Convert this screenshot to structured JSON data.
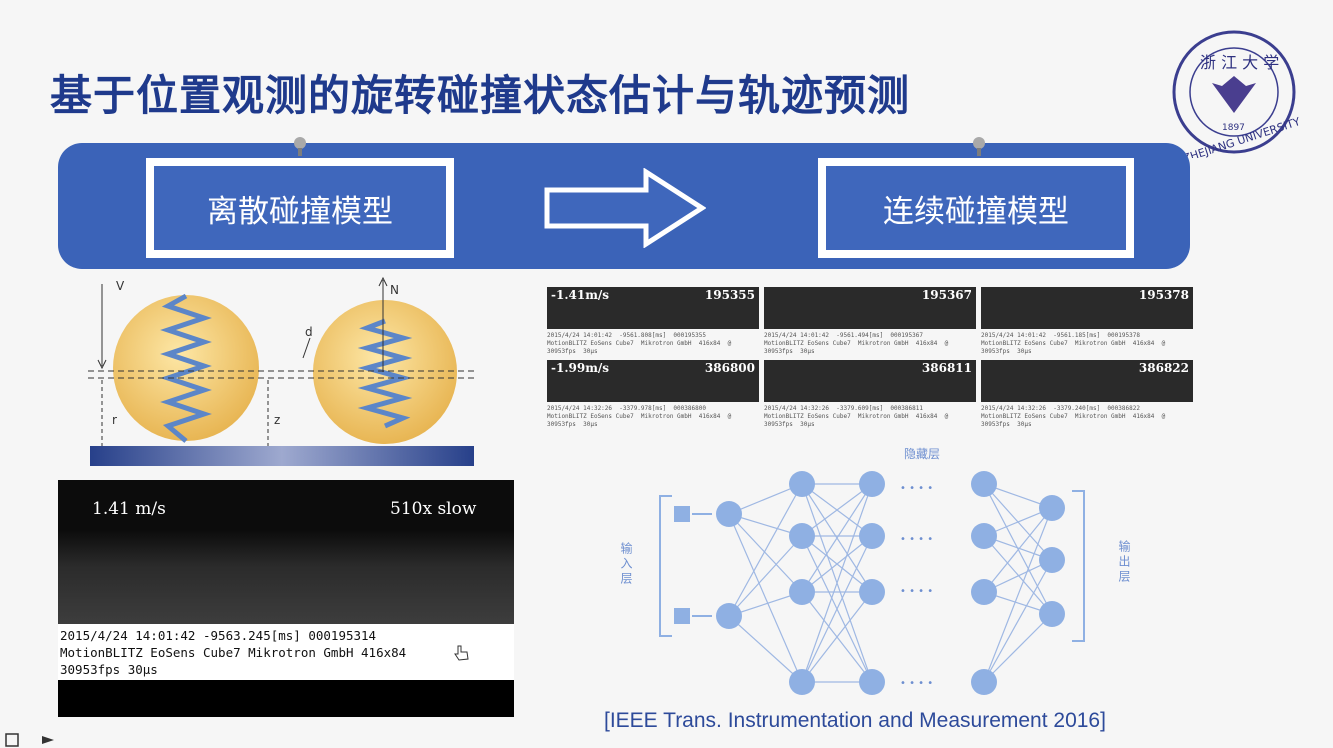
{
  "title": "基于位置观测的旋转碰撞状态估计与轨迹预测",
  "banner": {
    "left_label": "离散碰撞模型",
    "right_label": "连续碰撞模型"
  },
  "diagram": {
    "v_label": "V",
    "n_label": "N",
    "dc_label": "d",
    "r_label": "r",
    "z_label": "z"
  },
  "frames": [
    {
      "speed": "-1.41m/s",
      "id": "195355",
      "caption": "2015/4/24 14:01:42  -9561.808[ms]  000195355\nMotionBLITZ EoSens Cube7  Mikrotron GmbH  416x84  @\n30953fps  30µs"
    },
    {
      "speed": "",
      "id": "195367",
      "caption": "2015/4/24 14:01:42  -9561.494[ms]  000195367\nMotionBLITZ EoSens Cube7  Mikrotron GmbH  416x84  @\n30953fps  30µs"
    },
    {
      "speed": "",
      "id": "195378",
      "caption": "2015/4/24 14:01:42  -9561.185[ms]  000195378\nMotionBLITZ EoSens Cube7  Mikrotron GmbH  416x84  @\n30953fps  30µs"
    },
    {
      "speed": "-1.99m/s",
      "id": "386800",
      "caption": "2015/4/24 14:32:26  -3379.978[ms]  000386800\nMotionBLITZ EoSens Cube7  Mikrotron GmbH  416x84  @\n30953fps  30µs"
    },
    {
      "speed": "",
      "id": "386811",
      "caption": "2015/4/24 14:32:26  -3379.609[ms]  000386811\nMotionBLITZ EoSens Cube7  Mikrotron GmbH  416x84  @\n30953fps  30µs"
    },
    {
      "speed": "",
      "id": "386822",
      "caption": "2015/4/24 14:32:26  -3379.240[ms]  000386822\nMotionBLITZ EoSens Cube7  Mikrotron GmbH  416x84  @\n30953fps  30µs"
    }
  ],
  "video": {
    "speed": "1.41 m/s",
    "slow": "510x slow",
    "info_line1": "2015/4/24 14:01:42  -9563.245[ms]  000195314",
    "info_line2": "MotionBLITZ EoSens Cube7  Mikrotron GmbH  416x84",
    "info_line3": "30953fps  30µs"
  },
  "network": {
    "hidden_label": "隐藏层",
    "input_label": "输入层",
    "output_label": "输出层",
    "ellipsis": "• • • •"
  },
  "logo": {
    "name_cn": "浙 江 大 学",
    "year": "1897",
    "name_en": "ZHEJIANG UNIVERSITY"
  },
  "citation": "[IEEE Trans. Instrumentation and Measurement  2016]",
  "colors": {
    "title": "#1f3a8c",
    "banner": "#3b63b8",
    "nn_node": "#8fb0e3",
    "spring": "#5c86c8",
    "ball": "#f0c56a"
  }
}
